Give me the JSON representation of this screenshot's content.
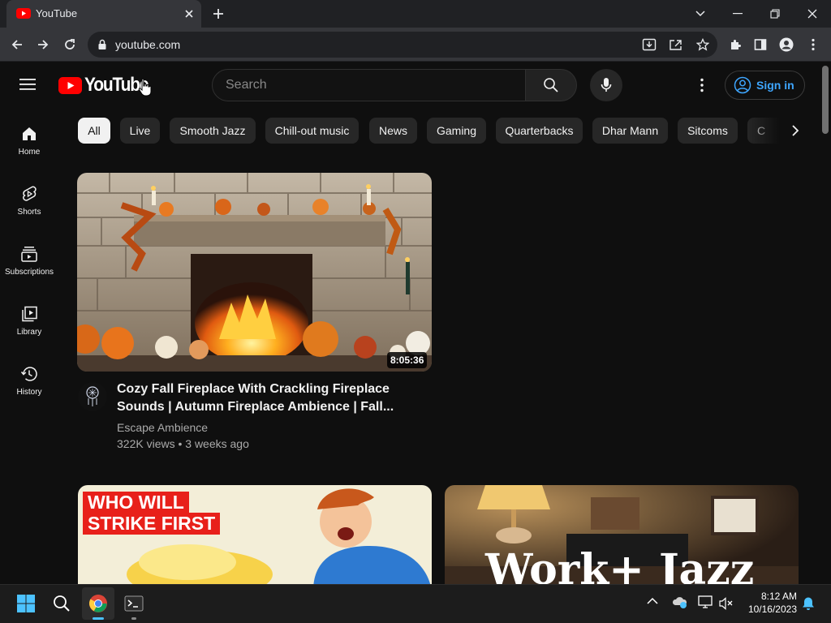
{
  "browser": {
    "tab_title": "YouTube",
    "url": "youtube.com"
  },
  "youtube": {
    "logo_text": "YouTube",
    "search_placeholder": "Search",
    "sign_in_label": "Sign in",
    "rail": [
      {
        "label": "Home",
        "icon": "home-icon"
      },
      {
        "label": "Shorts",
        "icon": "shorts-icon"
      },
      {
        "label": "Subscriptions",
        "icon": "subscriptions-icon"
      },
      {
        "label": "Library",
        "icon": "library-icon"
      },
      {
        "label": "History",
        "icon": "history-icon"
      }
    ],
    "chips": [
      "All",
      "Live",
      "Smooth Jazz",
      "Chill-out music",
      "News",
      "Gaming",
      "Quarterbacks",
      "Dhar Mann",
      "Sitcoms",
      "C"
    ],
    "active_chip": "All",
    "videos": [
      {
        "title": "Cozy Fall Fireplace With Crackling Fireplace Sounds | Autumn Fireplace Ambience | Fall...",
        "title_line1": "Cozy Fall Fireplace With Crackling Fireplace",
        "title_line2": "Sounds | Autumn Fireplace Ambience | Fall...",
        "channel": "Escape Ambience",
        "meta": "322K views • 3 weeks ago",
        "duration": "8:05:36"
      },
      {
        "thumb_text_line1": "WHO WILL",
        "thumb_text_line2": "STRIKE FIRST"
      },
      {
        "thumb_text": "Work+ Jazz"
      }
    ]
  },
  "taskbar": {
    "time": "8:12 AM",
    "date": "10/16/2023"
  },
  "colors": {
    "youtube_red": "#ff0000",
    "link_blue": "#3ea6ff",
    "background": "#0f0f0f"
  }
}
